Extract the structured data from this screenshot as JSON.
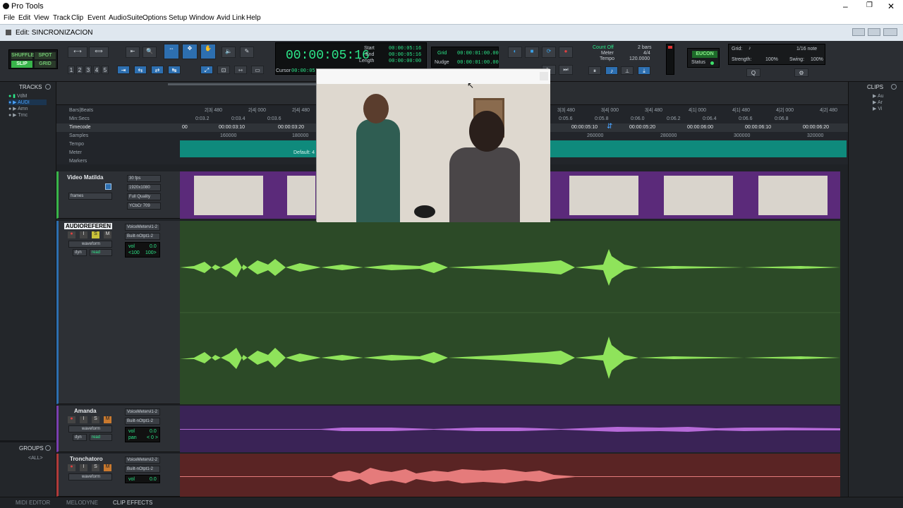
{
  "app": {
    "title": "Pro Tools"
  },
  "menu": [
    "File",
    "Edit",
    "View",
    "Track",
    "Clip",
    "Event",
    "AudioSuite",
    "Options",
    "Setup",
    "Window",
    "Avid Link",
    "Help"
  ],
  "window": {
    "title": "Edit: SINCRONIZACION"
  },
  "edit_modes": {
    "shuffle": "SHUFFLE",
    "spot": "SPOT",
    "slip": "SLIP",
    "grid": "GRID"
  },
  "zoom_presets": [
    "1",
    "2",
    "3",
    "4",
    "5"
  ],
  "counter": {
    "main": "00:00:05:16",
    "start_label": "Start",
    "end_label": "End",
    "length_label": "Length",
    "start": "00:00:05:16",
    "end": "00:00:05:16",
    "length": "00:00:00:00",
    "cursor_label": "Cursor",
    "cursor": "00:00:05:08"
  },
  "grid_nudge": {
    "grid_label": "Grid",
    "grid_value": "00:00:01:00.00",
    "nudge_label": "Nudge",
    "nudge_value": "00:00:01:00.00"
  },
  "tempo": {
    "count_off": "Count Off",
    "bars": "2 bars",
    "meter_label": "Meter",
    "meter": "4/4",
    "tempo_label": "Tempo",
    "tempo": "120.0000"
  },
  "eucon": {
    "label": "EUCON",
    "status": "Status"
  },
  "grid_settings": {
    "grid_label": "Grid:",
    "note": "1/16 note",
    "strength_label": "Strength:",
    "strength": "100%",
    "swing_label": "Swing:",
    "swing": "100%"
  },
  "tracks_panel": {
    "title": "TRACKS",
    "items": [
      "VdM",
      "AUDI",
      "Amn",
      "Trnc"
    ]
  },
  "groups_panel": {
    "title": "GROUPS",
    "all": "<ALL>"
  },
  "clips_panel": {
    "title": "CLIPS",
    "items": [
      "Au",
      "Ar",
      "Vi"
    ]
  },
  "rulers": {
    "bars_label": "Bars|Beats",
    "minsecs_label": "Min:Secs",
    "timecode_label": "Timecode",
    "samples_label": "Samples",
    "tempo_label": "Tempo",
    "meter_label": "Meter",
    "markers_label": "Markers",
    "meter_default": "Default: 4",
    "timecode_ticks": [
      "00",
      "00:00:03:10",
      "00:00:03:20",
      "00:00:05:10",
      "00:00:05:20",
      "00:00:06:00",
      "00:00:06:10",
      "00:00:06:20"
    ],
    "sample_ticks": [
      "160000",
      "180000",
      "260000",
      "280000",
      "300000",
      "320000"
    ],
    "bar_ticks": [
      "2|3| 480",
      "2|4| 000",
      "2|4| 480",
      "3|3| 480",
      "3|4| 000",
      "3|4| 480",
      "4|1| 000",
      "4|1| 480",
      "4|2| 000",
      "4|2| 480"
    ],
    "minsec_ticks": [
      "0:03.2",
      "0:03.4",
      "0:03.6",
      "0:05.6",
      "0:05.8",
      "0:06.0",
      "0:06.2",
      "0:06.4",
      "0:06.6",
      "0:06.8"
    ]
  },
  "video_track": {
    "name": "Video Matilda",
    "fps": "30 fps",
    "res": "1920x1080",
    "frames": "frames",
    "quality": "Full Quality",
    "color": "YCbCr 709"
  },
  "audio_track": {
    "name": "AUDIOREFEREN",
    "input": "VoiceMetervi1-2",
    "output": "Built-nOtpt1-2",
    "view": "waveform",
    "dyn": "dyn",
    "mode": "read",
    "vol_label": "vol",
    "vol": "0.0",
    "pan_l": "<100",
    "pan_r": "100>"
  },
  "amanda_track": {
    "name": "Amanda",
    "input": "VoiceMetervi1-2",
    "output": "Built-nOtpt1-2",
    "view": "waveform",
    "dyn": "dyn",
    "mode": "read",
    "vol_label": "vol",
    "vol": "0.0",
    "pan_label": "pan",
    "pan": "< 0 >"
  },
  "tronchatoro_track": {
    "name": "Tronchatoro",
    "input": "VoiceMetervi2-2",
    "output": "Built-nOtpt1-2",
    "view": "waveform",
    "vol_label": "vol",
    "vol": "0.0"
  },
  "track_buttons": {
    "solo": "S",
    "mute": "M",
    "input": "I"
  },
  "bottom_tabs": [
    "MIDI EDITOR",
    "MELODYNE",
    "CLIP EFFECTS"
  ],
  "colors": {
    "audio_lane": "#2c4a27",
    "waveform": "#8fe35b",
    "video_lane": "#5b2a7a",
    "amanda_lane": "#3a2356",
    "amanda_wave": "#b66ad8",
    "tronch_lane": "#5a2424",
    "tronch_wave": "#e57b7b",
    "counter_green": "#2ce88a"
  }
}
